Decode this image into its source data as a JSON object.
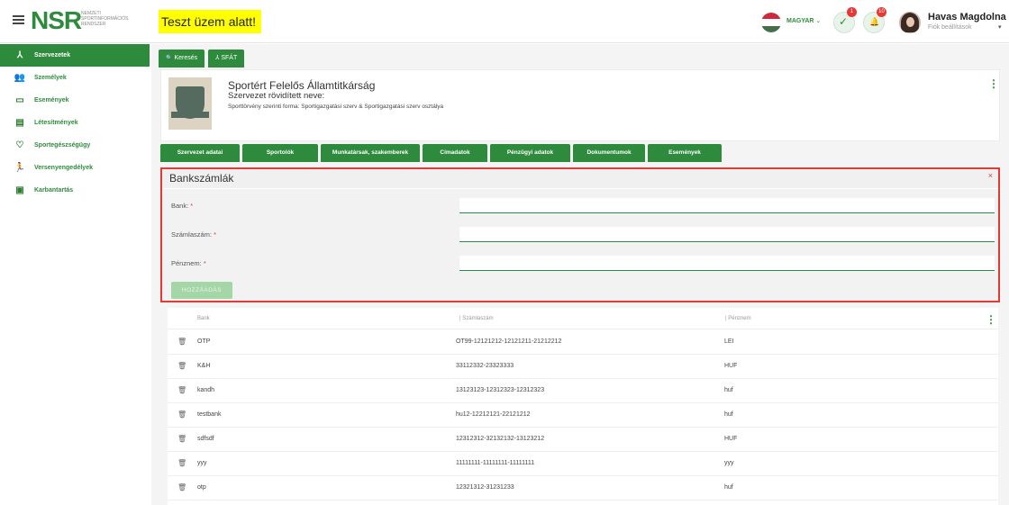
{
  "header": {
    "logo_text": "NSR",
    "logo_sub": [
      "NEMZETI",
      "SPORTINFORMÁCIÓS",
      "RENDSZER"
    ],
    "test_badge": "Teszt üzem alatt!",
    "language": "MAGYAR",
    "language_caret": "⌄",
    "tasks_icon": "✓",
    "tasks_badge": "1",
    "notif_icon": "🔔",
    "notif_badge": "10",
    "user_name": "Havas Magdolna",
    "user_sub": "Fiók beállítások",
    "user_caret": "▾",
    "flag_colors": [
      "#cd2a3e",
      "#ffffff",
      "#436f4d"
    ]
  },
  "sidebar": {
    "items": [
      {
        "label": "Szervezetek",
        "icon": "⅄"
      },
      {
        "label": "Személyek",
        "icon": "👥"
      },
      {
        "label": "Események",
        "icon": "▭"
      },
      {
        "label": "Létesítmények",
        "icon": "▤"
      },
      {
        "label": "Sportegészségügy",
        "icon": "♡"
      },
      {
        "label": "Versenyengedélyek",
        "icon": "🏃"
      },
      {
        "label": "Karbantartás",
        "icon": "▣"
      }
    ]
  },
  "main": {
    "top_tabs": [
      {
        "label": "Keresés",
        "icon": "🔍"
      },
      {
        "label": "SFÁT",
        "icon": "⅄"
      }
    ],
    "org": {
      "title": "Sportért Felelős Államtitkárság",
      "short_name_label": "Szervezet rövidített neve:",
      "form": "Sporttörvény szerinti forma: Sportigazgatási szerv & Sportigazgatási szerv osztálya"
    },
    "kebab": "⋮",
    "sub_tabs": [
      "Szervezet adatai",
      "Sportolók",
      "Munkatársak, szakemberek",
      "Címadatok",
      "Pénzügyi adatok",
      "Dokumentumok",
      "Események"
    ]
  },
  "bank_form": {
    "title": "Bankszámlák",
    "close": "×",
    "bank_label": "Bank:",
    "account_label": "Számlaszám:",
    "currency_label": "Pénznem:",
    "required_mark": "*",
    "add_button": "HOZZÁADÁS"
  },
  "bank_table": {
    "headers": [
      "Bank",
      "| Számlaszám",
      "| Pénznem"
    ],
    "delete_icon": "🗑",
    "rows": [
      {
        "bank": "OTP",
        "account": "OT99-12121212-12121211-21212212",
        "currency": "LEI"
      },
      {
        "bank": "K&H",
        "account": "33112332-23323333",
        "currency": "HUF"
      },
      {
        "bank": "kandh",
        "account": "13123123-12312323-12312323",
        "currency": "huf"
      },
      {
        "bank": "testbank",
        "account": "hu12-12212121-22121212",
        "currency": "huf"
      },
      {
        "bank": "sdfsdf",
        "account": "12312312-32132132-13123212",
        "currency": "HUF"
      },
      {
        "bank": "yyy",
        "account": "11111111-11111111-11111111",
        "currency": "yyy"
      },
      {
        "bank": "otp",
        "account": "12321312-31231233",
        "currency": "huf"
      }
    ]
  }
}
